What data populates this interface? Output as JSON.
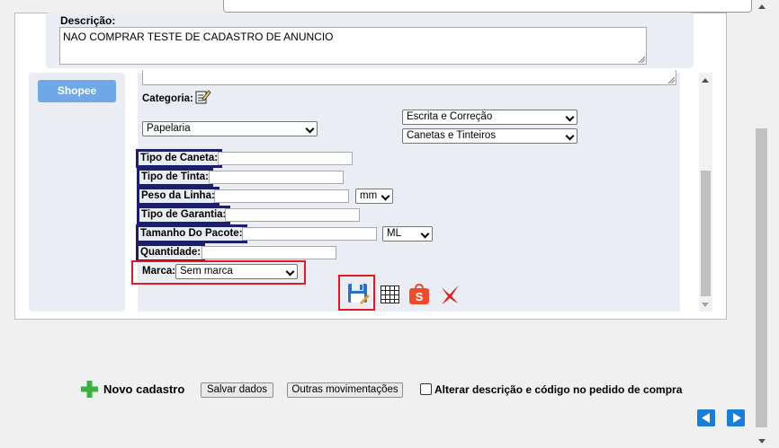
{
  "description": {
    "label": "Descrição:",
    "value": "NAO COMPRAR TESTE DE CADASTRO DE ANUNCIO"
  },
  "tabs": {
    "shopee_label": "Shopee"
  },
  "category": {
    "label": "Categoria:",
    "level1": "Papelaria",
    "level2": "Escrita e Correção",
    "level3": "Canetas e Tinteiros"
  },
  "attributes": {
    "tipo_caneta_label": "Tipo de Caneta:",
    "tipo_tinta_label": "Tipo de Tinta:",
    "peso_linha_label": "Peso da Linha:",
    "peso_linha_unit": "mm",
    "tipo_garantia_label": "Tipo de Garantia:",
    "tamanho_pacote_label": "Tamanho Do Pacote:",
    "tamanho_pacote_unit": "ML",
    "quantidade_label": "Quantidade:",
    "marca_label": "Marca:",
    "marca_value": "Sem marca"
  },
  "footer": {
    "novo_cadastro_label": "Novo cadastro",
    "salvar_dados_label": "Salvar dados",
    "outras_mov_label": "Outras movimentações",
    "alterar_label": "Alterar descrição e código no pedido de compra"
  },
  "icons": {
    "edit_category": "edit-icon",
    "save": "save-icon",
    "grid": "grid-icon",
    "shopee": "shopee-icon",
    "delete": "delete-icon",
    "add": "plus-icon",
    "prev": "arrow-left-icon",
    "next": "arrow-right-icon"
  },
  "colors": {
    "accent_blue": "#6fa8e8",
    "highlight_navy": "#1a1f6e",
    "highlight_red": "#e01b24",
    "plus_green": "#3cb043",
    "nav_blue": "#1c7cd6"
  }
}
